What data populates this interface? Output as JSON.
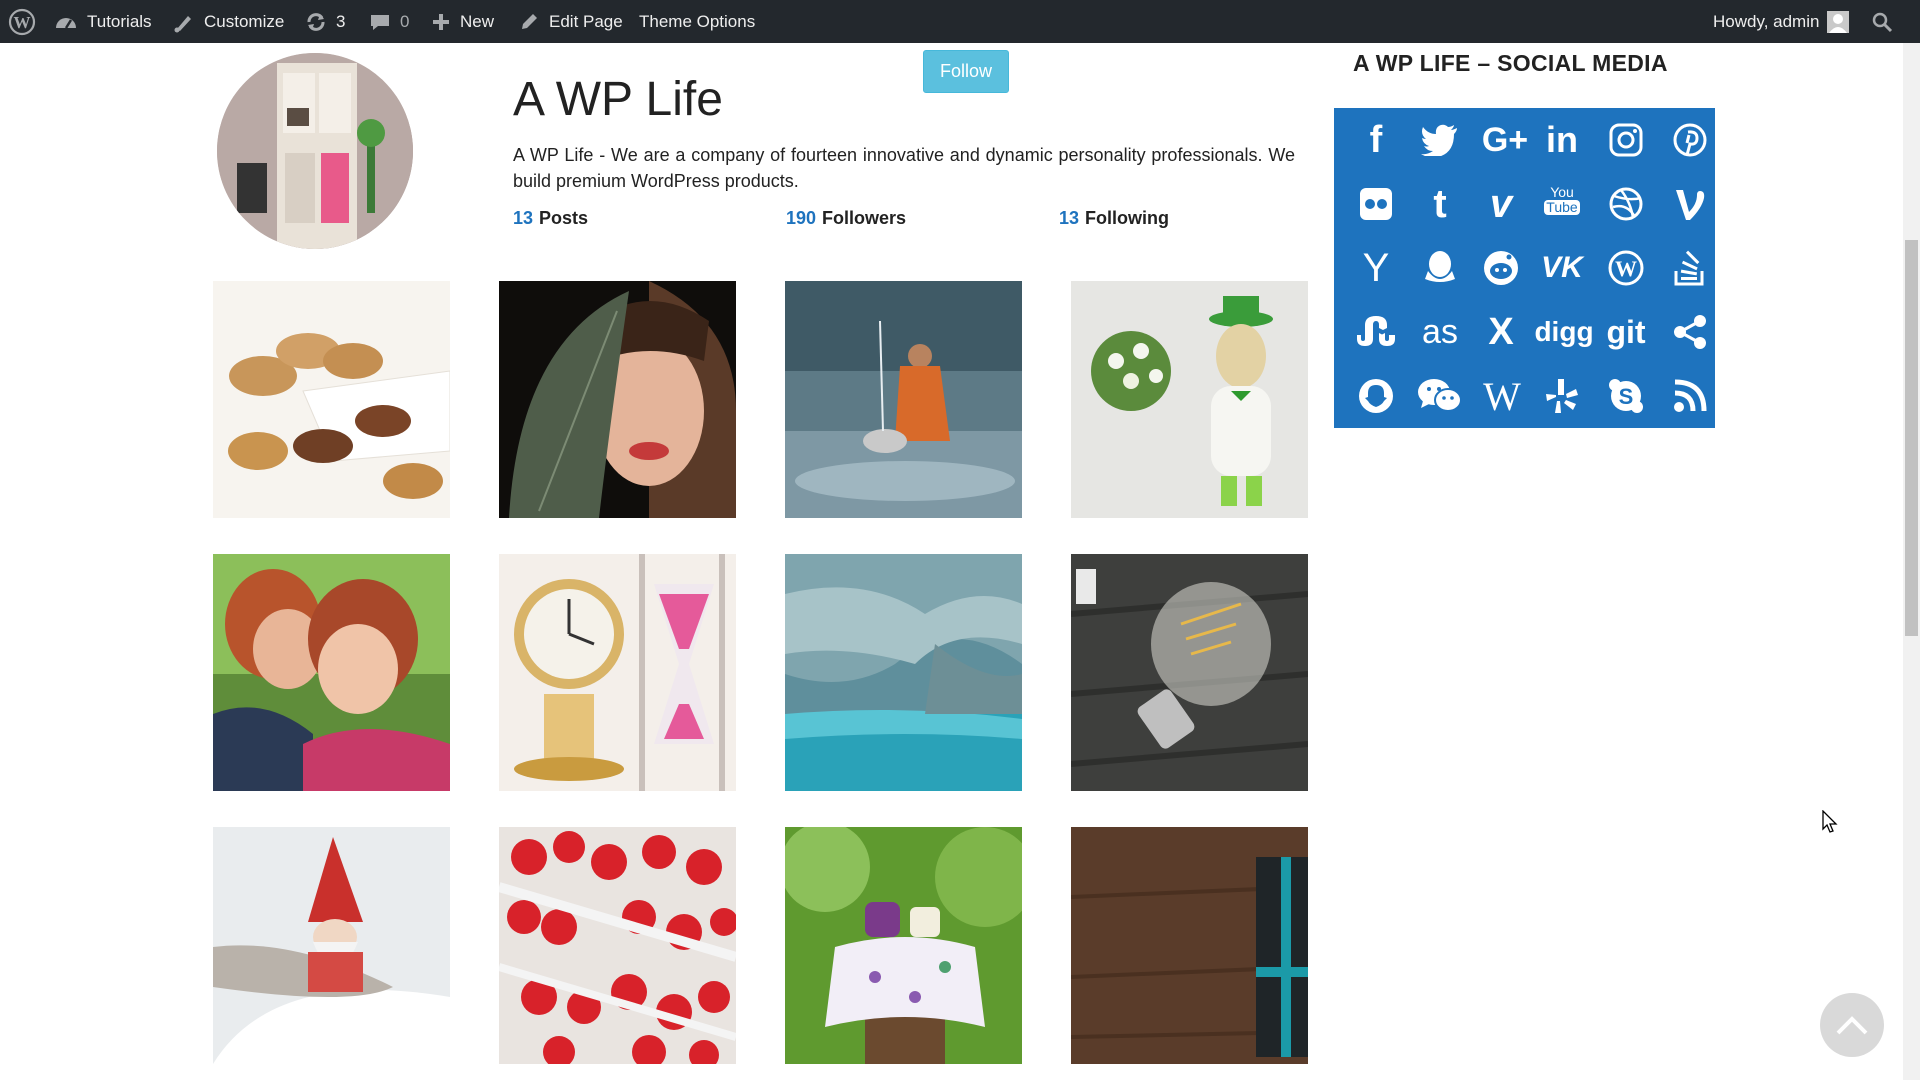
{
  "admin_bar": {
    "site_label": "Tutorials",
    "customize_label": "Customize",
    "updates_count": "3",
    "comments_count": "0",
    "new_label": "New",
    "edit_page_label": "Edit Page",
    "theme_options_label": "Theme Options",
    "greeting": "Howdy, admin"
  },
  "profile": {
    "name": "A WP Life",
    "bio": "A WP Life - We are a company of fourteen innovative and dynamic personality professionals. We build premium WordPress products.",
    "follow_label": "Follow",
    "stats": [
      {
        "count": "13",
        "label": "Posts"
      },
      {
        "count": "190",
        "label": "Followers"
      },
      {
        "count": "13",
        "label": "Following"
      }
    ]
  },
  "gallery": {
    "items": [
      "pecans-photo",
      "woman-leaf-photo",
      "monk-river-photo",
      "figurine-flowers-photo",
      "kids-photo",
      "clock-hourglass-photo",
      "ice-cave-photo",
      "lightbulb-photo",
      "gnome-snow-photo",
      "strawberries-photo",
      "garden-tea-photo",
      "gift-box-photo"
    ]
  },
  "sidebar": {
    "widget_title": "A WP LIFE – SOCIAL MEDIA",
    "box_color": "#1e73be",
    "icons": [
      "facebook-icon",
      "twitter-icon",
      "google-plus-icon",
      "linkedin-icon",
      "instagram-icon",
      "pinterest-icon",
      "flickr-icon",
      "tumblr-icon",
      "vimeo-icon",
      "youtube-icon",
      "dribbble-icon",
      "vine-icon",
      "hacker-news-icon",
      "qq-icon",
      "reddit-icon",
      "vk-icon",
      "wordpress-icon",
      "stackoverflow-icon",
      "stumbleupon-icon",
      "lastfm-icon",
      "xing-icon",
      "digg-icon",
      "git-icon",
      "share-icon",
      "snapchat-icon",
      "wechat-icon",
      "wikipedia-icon",
      "yelp-icon",
      "skype-icon",
      "rss-icon"
    ],
    "text_glyphs": {
      "google_plus": "G+",
      "linkedin": "in",
      "tumblr": "t",
      "vimeo": "v",
      "youtube_top": "You",
      "youtube_bottom": "Tube",
      "hacker_news": "Y",
      "vk": "VK",
      "wordpress": "W",
      "lastfm": "as",
      "xing": "X",
      "digg": "digg",
      "git": "git",
      "wikipedia": "W",
      "skype": "S",
      "facebook": "f"
    }
  }
}
